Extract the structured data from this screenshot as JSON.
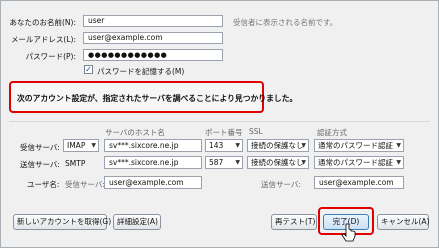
{
  "account": {
    "name_label": "あなたのお名前(N):",
    "name_value": "user",
    "name_hint": "受信者に表示される名前です。",
    "email_label": "メールアドレス(L):",
    "email_value": "user@example.com",
    "password_label": "パスワード(P):",
    "password_value": "●●●●●●●●●●●●",
    "remember_label": "パスワードを記憶する(M)",
    "remember_checked": "✓"
  },
  "notice": {
    "message": "次のアカウント設定が、指定されたサーバを調べることにより見つかりました。"
  },
  "server": {
    "col_host": "サーバのホスト名",
    "col_port": "ポート番号",
    "col_ssl": "SSL",
    "col_auth": "認証方式",
    "incoming_label": "受信サーバ:",
    "incoming_type": "IMAP",
    "incoming_host": "sv***.sixcore.ne.jp",
    "incoming_port": "143",
    "incoming_ssl": "接続の保護なし",
    "incoming_auth": "通常のパスワード認証",
    "outgoing_label": "送信サーバ:",
    "outgoing_type": "SMTP",
    "outgoing_host": "sv***.sixcore.ne.jp",
    "outgoing_port": "587",
    "outgoing_ssl": "接続の保護なし",
    "outgoing_auth": "通常のパスワード認証",
    "username_label": "ユーザ名:",
    "incoming_user_label": "受信サーバ:",
    "incoming_user": "user@example.com",
    "outgoing_user_label": "送信サーバ:",
    "outgoing_user": "user@example.com"
  },
  "buttons": {
    "get_new_account": "新しいアカウントを取得(G)",
    "advanced": "詳細設定(A)",
    "retest": "再テスト(T)",
    "done": "完了(D)",
    "cancel": "キャンセル(A)"
  },
  "icons": {
    "dropdown": "▼",
    "cursor": "mouse-pointer-icon"
  }
}
